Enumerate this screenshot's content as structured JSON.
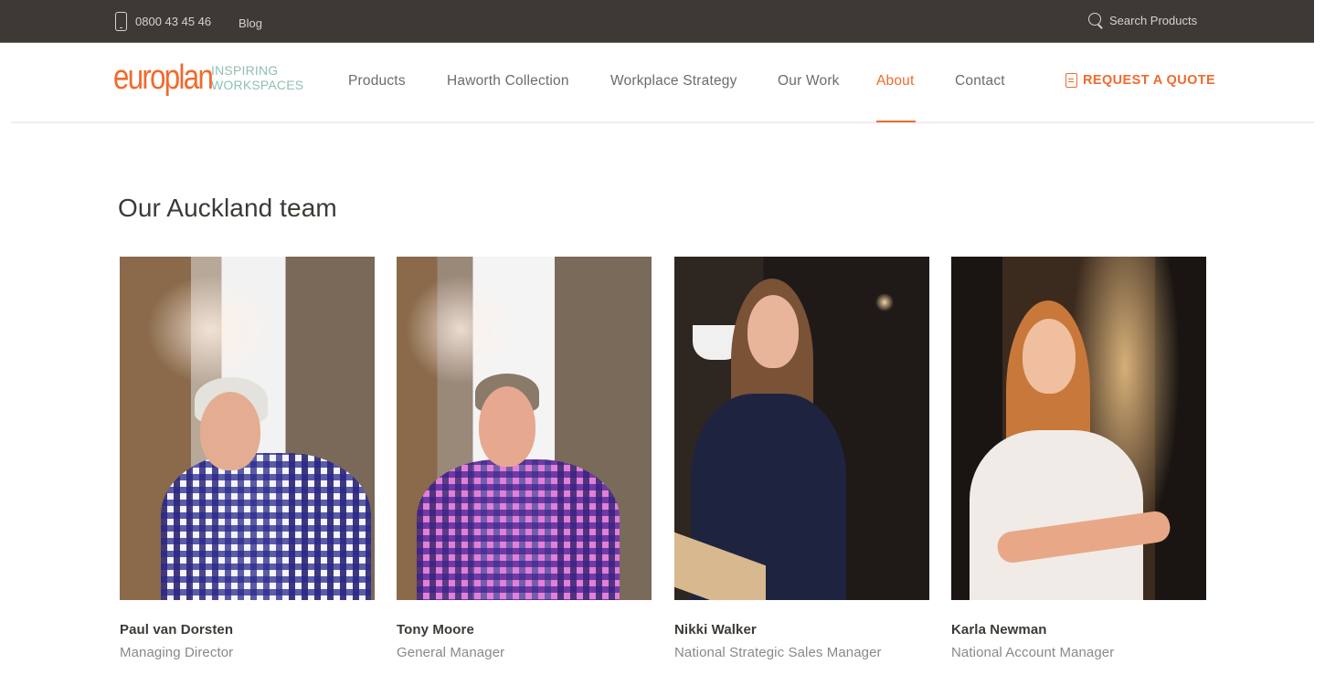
{
  "topbar": {
    "phone": "0800 43 45 46",
    "blog_label": "Blog",
    "search_placeholder": "Search Products",
    "icons": {
      "phone": "mobile-phone-icon",
      "search": "search-icon"
    }
  },
  "brand": {
    "wordmark": "europlan",
    "tagline_line1": "INSPIRING",
    "tagline_line2": "WORKSPACES",
    "primary_color": "#f16a2d",
    "tagline_color": "#8fbfb6"
  },
  "nav": {
    "items": [
      {
        "label": "Products",
        "active": false
      },
      {
        "label": "Haworth Collection",
        "active": false
      },
      {
        "label": "Workplace Strategy",
        "active": false
      },
      {
        "label": "Our Work",
        "active": false
      },
      {
        "label": "About",
        "active": true
      },
      {
        "label": "Contact",
        "active": false
      }
    ],
    "cta_label": "REQUEST A QUOTE",
    "cta_icon": "document-icon"
  },
  "main": {
    "title": "Our Auckland team",
    "team": [
      {
        "name": "Paul van Dorsten",
        "role": "Managing Director"
      },
      {
        "name": "Tony Moore",
        "role": "General Manager"
      },
      {
        "name": "Nikki Walker",
        "role": "National Strategic Sales Manager"
      },
      {
        "name": "Karla Newman",
        "role": "National Account Manager"
      }
    ]
  }
}
